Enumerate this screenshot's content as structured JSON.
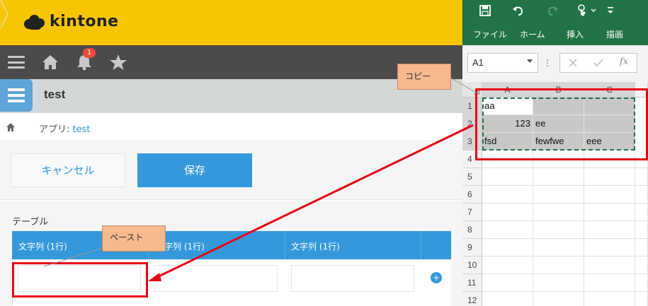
{
  "kintone": {
    "logo_text": "kintone",
    "notification_count": "1",
    "app_title": "test",
    "breadcrumb": {
      "prefix": "アプリ: ",
      "link": "test"
    },
    "buttons": {
      "cancel": "キャンセル",
      "save": "保存"
    },
    "table": {
      "label": "テーブル",
      "columns": [
        "文字列 (1行)",
        "字列 (1行)",
        "文字列 (1行)"
      ],
      "add_row_symbol": "+"
    },
    "colors": {
      "header": "#f7c600",
      "nav": "#4b4b4b",
      "accent": "#3498db"
    }
  },
  "excel": {
    "ribbon_tabs": [
      "ファイル",
      "ホーム",
      "挿入",
      "描画"
    ],
    "name_box": "A1",
    "fx_symbol": "fx",
    "columns": [
      "A",
      "B",
      "C"
    ],
    "rows": [
      "1",
      "2",
      "3",
      "4",
      "5",
      "6",
      "7",
      "8",
      "9",
      "10",
      "11",
      "12"
    ],
    "cells": {
      "r1": [
        "aa",
        "",
        ""
      ],
      "r2": [
        "123",
        "ee",
        ""
      ],
      "r3": [
        "fsd",
        "fewfwe",
        "eee"
      ]
    },
    "colors": {
      "ribbon": "#217346"
    }
  },
  "annotations": {
    "copy_label": "コピー",
    "paste_label": "ペースト",
    "highlight_color": "#e60012"
  }
}
